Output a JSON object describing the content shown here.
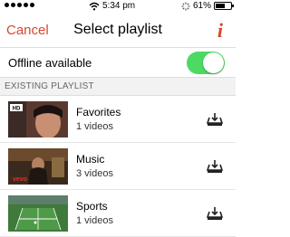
{
  "status_bar": {
    "time": "5:34 pm",
    "battery_percent": "61%",
    "battery_level": 0.61,
    "signal_dots": 5,
    "icons": [
      "wifi-icon",
      "activity-icon",
      "battery-icon"
    ]
  },
  "nav": {
    "cancel_label": "Cancel",
    "title": "Select playlist",
    "info_label": "i"
  },
  "offline": {
    "label": "Offline available",
    "enabled": true
  },
  "section": {
    "header": "EXISTING PLAYLIST"
  },
  "playlists": [
    {
      "title": "Favorites",
      "subtitle": "1 videos",
      "thumb_badge": "HD"
    },
    {
      "title": "Music",
      "subtitle": "3 videos",
      "thumb_badge": "vevo"
    },
    {
      "title": "Sports",
      "subtitle": "1 videos",
      "thumb_badge": ""
    }
  ],
  "colors": {
    "accent": "#d9452b",
    "toggle_on": "#4cd964"
  }
}
